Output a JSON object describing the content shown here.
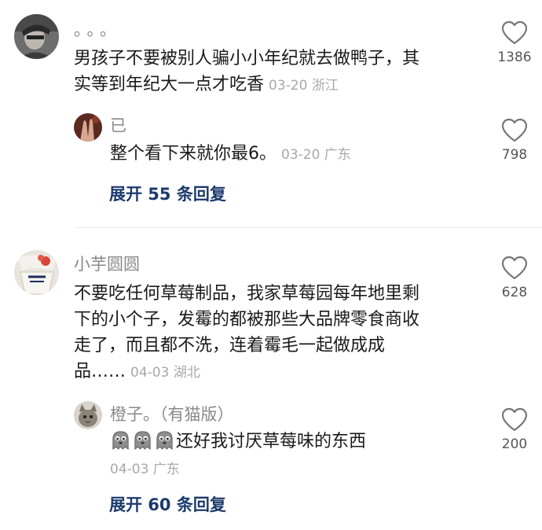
{
  "comments": [
    {
      "username": "。。。",
      "text_lines": [
        "男孩子不要被别人骗小小年纪就去做鸭子，其",
        "实等到年纪大一点才吃香"
      ],
      "meta": "03-20 浙江",
      "likes": "1386",
      "reply": {
        "username": "已",
        "text": "整个看下来就你最6。",
        "meta": "03-20 广东",
        "likes": "798"
      },
      "expand_label": "展开 55 条回复"
    },
    {
      "username": "小芋圆圆",
      "text_lines": [
        "不要吃任何草莓制品，我家草莓园每年地里剩",
        "下的小个子，发霉的都被那些大品牌零食商收",
        "走了，而且都不洗，连着霉毛一起做成成",
        "品……"
      ],
      "meta": "04-03 湖北",
      "likes": "628",
      "reply": {
        "username": "橙子。（有猫版）",
        "text": "还好我讨厌草莓味的东西",
        "emoji_count": 3,
        "emoji_name": "ghost-emoji",
        "meta": "04-03 广东",
        "likes": "200"
      },
      "expand_label": "展开 60 条回复"
    }
  ],
  "icons": {
    "like": "heart-outline-icon"
  },
  "colors": {
    "link": "#1c3a6b",
    "meta": "#a8a8a8",
    "username": "#8a8a8a"
  }
}
